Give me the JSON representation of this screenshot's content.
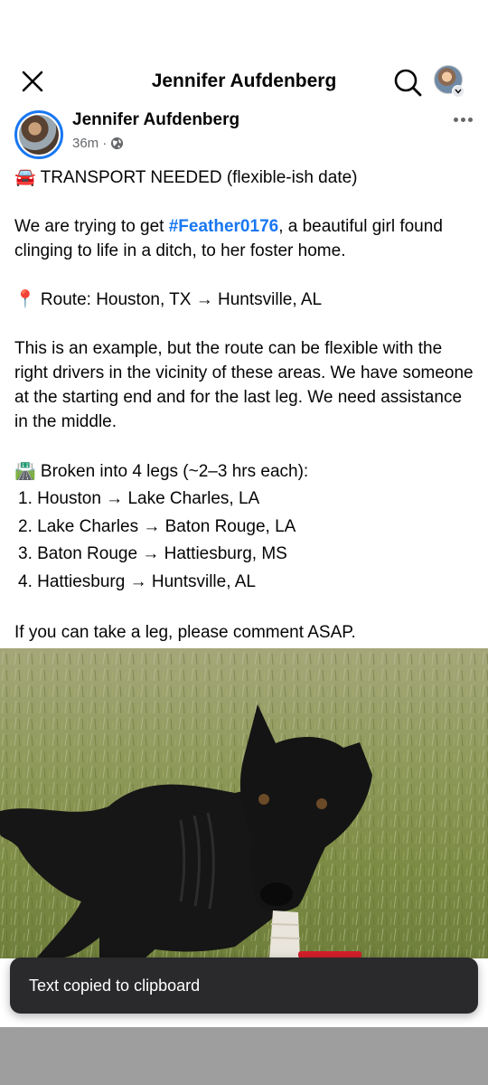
{
  "topbar": {
    "title": "Jennifer Aufdenberg",
    "icons": [
      "close-icon",
      "search-icon",
      "profile-avatar",
      "chevron-down-icon"
    ]
  },
  "post": {
    "author": "Jennifer Aufdenberg",
    "time": "36m",
    "separator": "·",
    "audience_icon": "globe-icon",
    "line_transport": "🚘 TRANSPORT NEEDED (flexible-ish date)",
    "intro_before": "We are trying to get ",
    "hashtag": "#Feather0176",
    "intro_after": ", a beautiful girl found clinging to life in a ditch, to her foster home.",
    "route": "📍 Route: Houston, TX → Huntsville, AL",
    "example": "This is an example, but the route can be flexible with the right drivers in the vicinity of these areas. We have someone at the starting end and for the last leg. We need assistance in the middle.",
    "legs_header": "🛣️ Broken into 4 legs (~2–3 hrs each):",
    "legs": [
      "1. Houston → Lake Charles, LA",
      "2. Lake Charles → Baton Rouge, LA",
      "3. Baton Rouge → Hattiesburg, MS",
      "4. Hattiesburg → Huntsville, AL"
    ],
    "cta": "If you can take a leg, please comment ASAP."
  },
  "photo": {
    "subject": "black dog lying in grass"
  },
  "toast": {
    "text": "Text copied to clipboard"
  },
  "colors": {
    "link": "#1877f2",
    "meta": "#65676b",
    "toast_bg": "#2a2a2c",
    "nav_gray": "#9e9e9e"
  }
}
